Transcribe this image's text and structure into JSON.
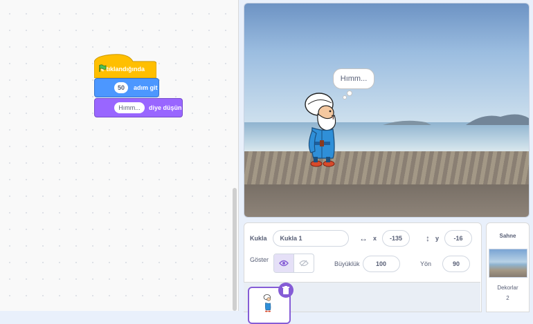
{
  "code": {
    "hat_block": {
      "label": "e tıklandığında",
      "icon": "green-flag-icon"
    },
    "move_block": {
      "value": "50",
      "label": "adım git"
    },
    "think_block": {
      "value": "Hımm...",
      "label": "diye düşün"
    }
  },
  "stage": {
    "bubble_text": "Hımm..."
  },
  "sprite_info": {
    "sprite_label": "Kukla",
    "sprite_name": "Kukla 1",
    "x_label": "x",
    "x_value": "-135",
    "y_label": "y",
    "y_value": "-16",
    "show_label": "Göster",
    "size_label": "Büyüklük",
    "size_value": "100",
    "direction_label": "Yön",
    "direction_value": "90"
  },
  "stage_pane": {
    "title": "Sahne",
    "backdrops_label": "Dekorlar",
    "backdrops_count": "2"
  },
  "colors": {
    "events": "#ffbf00",
    "motion": "#4c97ff",
    "looks": "#9966ff",
    "accent": "#855cd6"
  }
}
